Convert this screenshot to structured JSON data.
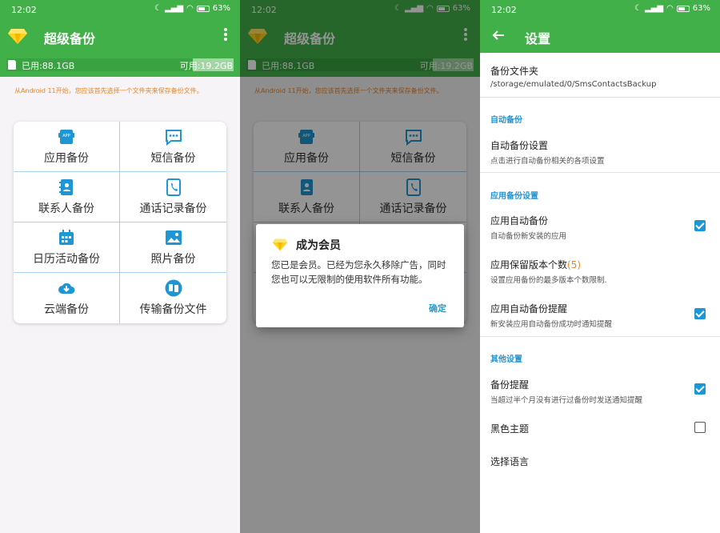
{
  "status": {
    "time": "12:02",
    "battery": "63%",
    "network": "HD",
    "signal": "4G"
  },
  "home": {
    "app_title": "超级备份",
    "storage": {
      "used_label": "已用:88.1GB",
      "free_label": "可用:19.2GB",
      "used_fraction": 0.82
    },
    "notice": "从Android 11开始，您应该首先选择一个文件夹来保存备份文件。",
    "tiles": [
      {
        "label": "应用备份",
        "icon": "app-icon"
      },
      {
        "label": "短信备份",
        "icon": "sms-icon"
      },
      {
        "label": "联系人备份",
        "icon": "contacts-icon"
      },
      {
        "label": "通话记录备份",
        "icon": "call-log-icon"
      },
      {
        "label": "日历活动备份",
        "icon": "calendar-icon"
      },
      {
        "label": "照片备份",
        "icon": "photo-icon"
      },
      {
        "label": "云端备份",
        "icon": "cloud-icon"
      },
      {
        "label": "传输备份文件",
        "icon": "transfer-icon"
      }
    ]
  },
  "dialog": {
    "title": "成为会员",
    "message": "您已是会员。已经为您永久移除广告，同时您也可以无限制的使用软件所有功能。",
    "ok": "确定"
  },
  "settings": {
    "title": "设置",
    "backup_folder": {
      "title": "备份文件夹",
      "path": "/storage/emulated/0/SmsContactsBackup"
    },
    "auto_backup_header": "自动备份",
    "auto_backup_settings": {
      "title": "自动备份设置",
      "summary": "点击进行自动备份相关的各项设置"
    },
    "app_backup_header": "应用备份设置",
    "app_auto_backup": {
      "title": "应用自动备份",
      "summary": "自动备份新安装的应用",
      "checked": true
    },
    "app_keep_versions": {
      "title": "应用保留版本个数",
      "count": "(5)",
      "summary": "设置应用备份的最多版本个数限制."
    },
    "app_auto_backup_notify": {
      "title": "应用自动备份提醒",
      "summary": "新安装应用自动备份成功时通知提醒",
      "checked": true
    },
    "other_header": "其他设置",
    "backup_reminder": {
      "title": "备份提醒",
      "summary": "当超过半个月没有进行过备份时发送通知提醒",
      "checked": true
    },
    "dark_theme": {
      "title": "黑色主题",
      "checked": false
    },
    "language": {
      "title": "选择语言"
    }
  },
  "colors": {
    "primary": "#42b049",
    "accent": "#1f96d3",
    "notice": "#e9862b"
  }
}
